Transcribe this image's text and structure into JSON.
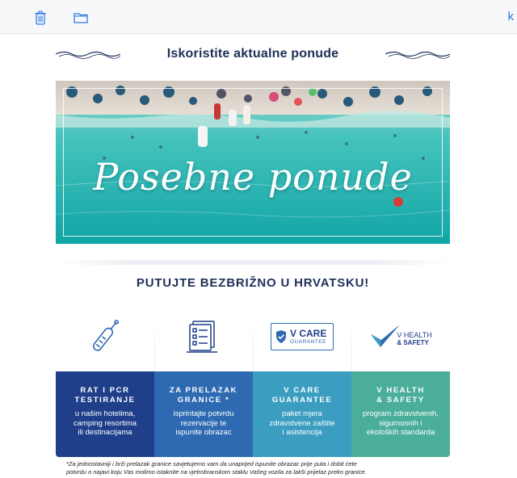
{
  "toolbar": {
    "extra_label": "k"
  },
  "email": {
    "headline": "Iskoristite aktualne ponude",
    "hero_title": "Posebne ponude",
    "subhead": "PUTUJTE BEZBRIŽNO U HRVATSKU!",
    "cards": [
      {
        "icon": "test-tube-icon",
        "title_line1": "RAT I PCR",
        "title_line2": "TESTIRANJE",
        "text_line1": "u našim hotelima,",
        "text_line2": "camping resortima",
        "text_line3": "ili destinacijama"
      },
      {
        "icon": "document-form-icon",
        "title_line1": "ZA PRELAZAK",
        "title_line2": "GRANICE *",
        "text_line1": "isprintajte potvrdu",
        "text_line2": "rezervacije te",
        "text_line3": "ispunite obrazac"
      },
      {
        "icon": "v-care-guarantee-logo",
        "logo_main": "V CARE",
        "logo_sub": "GUARANTEE",
        "title_line1": "V CARE",
        "title_line2": "GUARANTEE",
        "text_line1": "paket mjera",
        "text_line2": "zdravstvene zaštite",
        "text_line3": "i asistencija"
      },
      {
        "icon": "v-health-safety-logo",
        "logo_line1": "V HEALTH",
        "logo_line2": "& SAFETY",
        "title_line1": "V HEALTH",
        "title_line2": "& SAFETY",
        "text_line1": "program zdravstvenih,",
        "text_line2": "sigurnosnih i",
        "text_line3": "ekoloških standarda"
      }
    ],
    "footnote_line1": "*Za jednostavniji i brži prelazak granice savjetujemo vam da unaprijed ispunite obrazac prije puta i dobit ćete",
    "footnote_line2": "potvrdu o najavi koju Vas molimo istaknite na vjetrobranskom staklu Vašeg vozila za lakši prijelaz preko granice."
  },
  "colors": {
    "navy": "#1e2f57",
    "card1": "#1f3f8a",
    "card2": "#2e6ab2",
    "card3": "#3b9dc0",
    "card4": "#4aae9a",
    "link": "#2b77e5"
  }
}
